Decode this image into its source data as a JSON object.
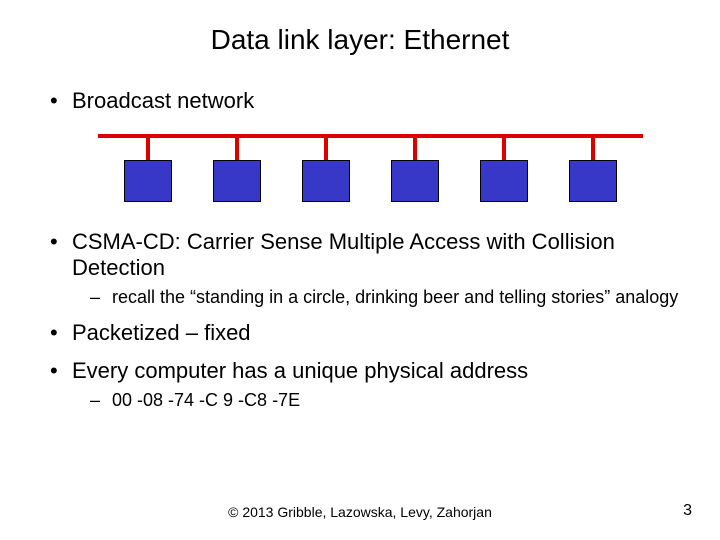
{
  "title": "Data link layer:  Ethernet",
  "bullets": {
    "b1": "Broadcast network",
    "b2": "CSMA-CD:  Carrier Sense Multiple Access with Collision Detection",
    "b2_sub": "recall the “standing in a circle, drinking beer and telling stories” analogy",
    "b3": "Packetized – fixed",
    "b4": "Every computer has a unique physical address",
    "b4_sub": "00 -08 -74 -C 9 -C8 -7E"
  },
  "footer": "© 2013 Gribble, Lazowska, Levy, Zahorjan",
  "page_number": "3",
  "diagram": {
    "bus_color": "#d00",
    "node_color": "#3838c8",
    "node_count": 6
  }
}
